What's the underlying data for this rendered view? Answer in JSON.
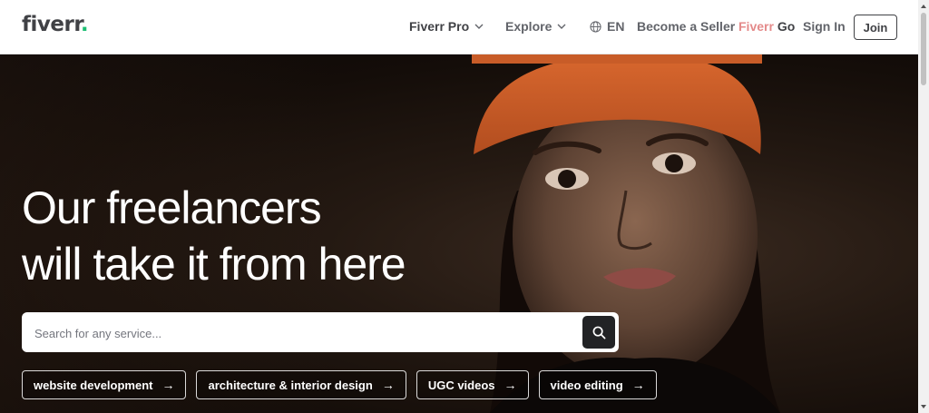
{
  "header": {
    "logo_text": "fiverr",
    "logo_dot": ".",
    "nav": {
      "pro_label": "Fiverr Pro",
      "explore_label": "Explore",
      "lang_label": "EN",
      "seller_label": "Become a Seller",
      "go_prefix": "Fiverr",
      "go_suffix": "Go",
      "signin_label": "Sign In",
      "join_label": "Join"
    }
  },
  "hero": {
    "headline_line1": "Our freelancers",
    "headline_line2": "will take it from here",
    "search": {
      "placeholder": "Search for any service..."
    },
    "tags": [
      {
        "label": "website development"
      },
      {
        "label": "architecture & interior design"
      },
      {
        "label": "UGC videos"
      },
      {
        "label": "video editing"
      }
    ],
    "tag_arrow": "→"
  },
  "colors": {
    "brand_green": "#1dbf73",
    "text_dark": "#404145",
    "text_gray": "#62646a",
    "search_button": "#222325"
  },
  "icons": [
    "chevron-down-icon",
    "globe-icon",
    "search-icon",
    "arrow-right-icon"
  ]
}
